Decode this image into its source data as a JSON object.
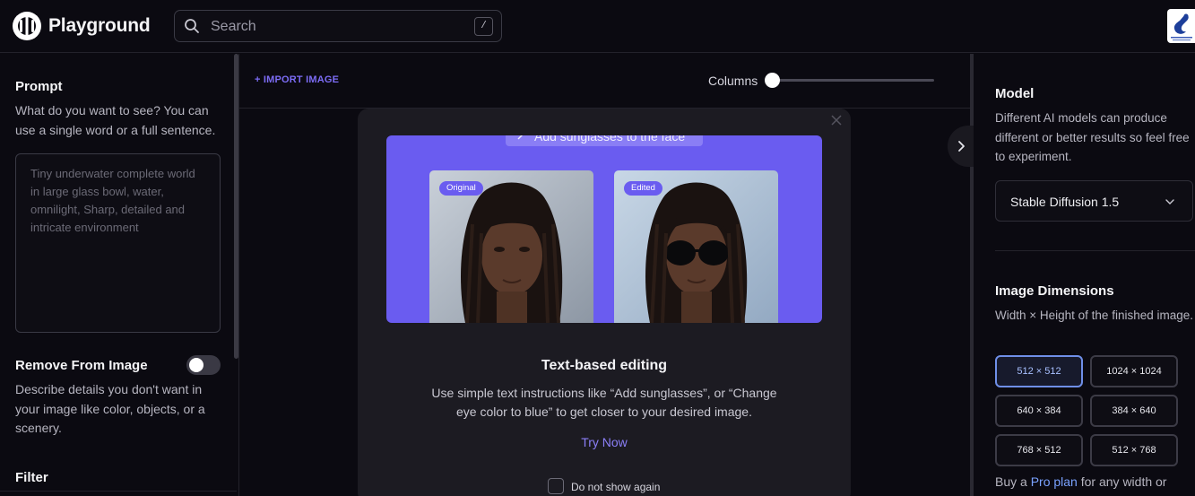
{
  "header": {
    "app_title": "Playground",
    "search_placeholder": "Search",
    "search_shortcut": "/"
  },
  "left_panel": {
    "prompt": {
      "title": "Prompt",
      "description": "What do you want to see? You can use a single word or a full sentence.",
      "placeholder": "Tiny underwater complete world in large glass bowl, water, omnilight, Sharp, detailed and intricate environment"
    },
    "remove": {
      "title": "Remove From Image",
      "description": "Describe details you don't want in your image like color, objects, or a scenery.",
      "toggle_on": false
    },
    "filter": {
      "title": "Filter"
    }
  },
  "center": {
    "import_label": "+ IMPORT IMAGE",
    "columns_label": "Columns"
  },
  "modal": {
    "hero_pill": "Add sunglasses to the face",
    "original_tag": "Original",
    "edited_tag": "Edited",
    "title": "Text-based editing",
    "description": "Use simple text instructions like “Add sunglasses”, or “Change eye color to blue” to get closer to your desired image.",
    "try_now": "Try Now",
    "dont_show_label": "Do not show again"
  },
  "right_panel": {
    "model": {
      "title": "Model",
      "description": "Different AI models can produce different or better results so feel free to experiment.",
      "selected": "Stable Diffusion 1.5"
    },
    "dimensions": {
      "title": "Image Dimensions",
      "description": "Width × Height of the finished image.",
      "options": [
        "512 × 512",
        "1024 × 1024",
        "640 × 384",
        "384 × 640",
        "768 × 512",
        "512 × 768"
      ],
      "selected_index": 0
    },
    "footer": {
      "prefix": "Buy a",
      "link": "Pro plan",
      "suffix": "for any width or"
    }
  },
  "colors": {
    "accent": "#6a5cf0",
    "link": "#7aa2ff",
    "background": "#0b0a11"
  }
}
